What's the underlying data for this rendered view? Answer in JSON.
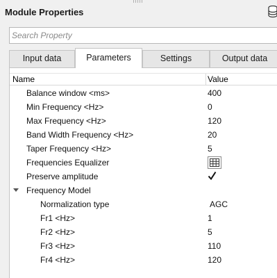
{
  "header": {
    "title": "Module Properties",
    "db_icon": "database-icon"
  },
  "search": {
    "placeholder": "Search Property"
  },
  "tabs": [
    {
      "label": "Input data",
      "active": false
    },
    {
      "label": "Parameters",
      "active": true
    },
    {
      "label": "Settings",
      "active": false
    },
    {
      "label": "Output data",
      "active": false
    }
  ],
  "grid": {
    "columns": {
      "name": "Name",
      "value": "Value"
    },
    "rows": [
      {
        "name": "Balance window <ms>",
        "value": "400"
      },
      {
        "name": "Min Frequency <Hz>",
        "value": "0"
      },
      {
        "name": "Max Frequency <Hz>",
        "value": "120"
      },
      {
        "name": "Band Width Frequency <Hz>",
        "value": "20"
      },
      {
        "name": "Taper Frequency <Hz>",
        "value": "5"
      },
      {
        "name": "Frequencies Equalizer",
        "value_icon": "grid-table-icon"
      },
      {
        "name": "Preserve amplitude",
        "checked": true
      },
      {
        "name": "Frequency Model",
        "expanded": true
      },
      {
        "name": "Normalization type",
        "value": "AGC"
      },
      {
        "name": "Fr1 <Hz>",
        "value": "1"
      },
      {
        "name": "Fr2 <Hz>",
        "value": "5"
      },
      {
        "name": "Fr3 <Hz>",
        "value": "110"
      },
      {
        "name": "Fr4 <Hz>",
        "value": "120"
      }
    ]
  }
}
